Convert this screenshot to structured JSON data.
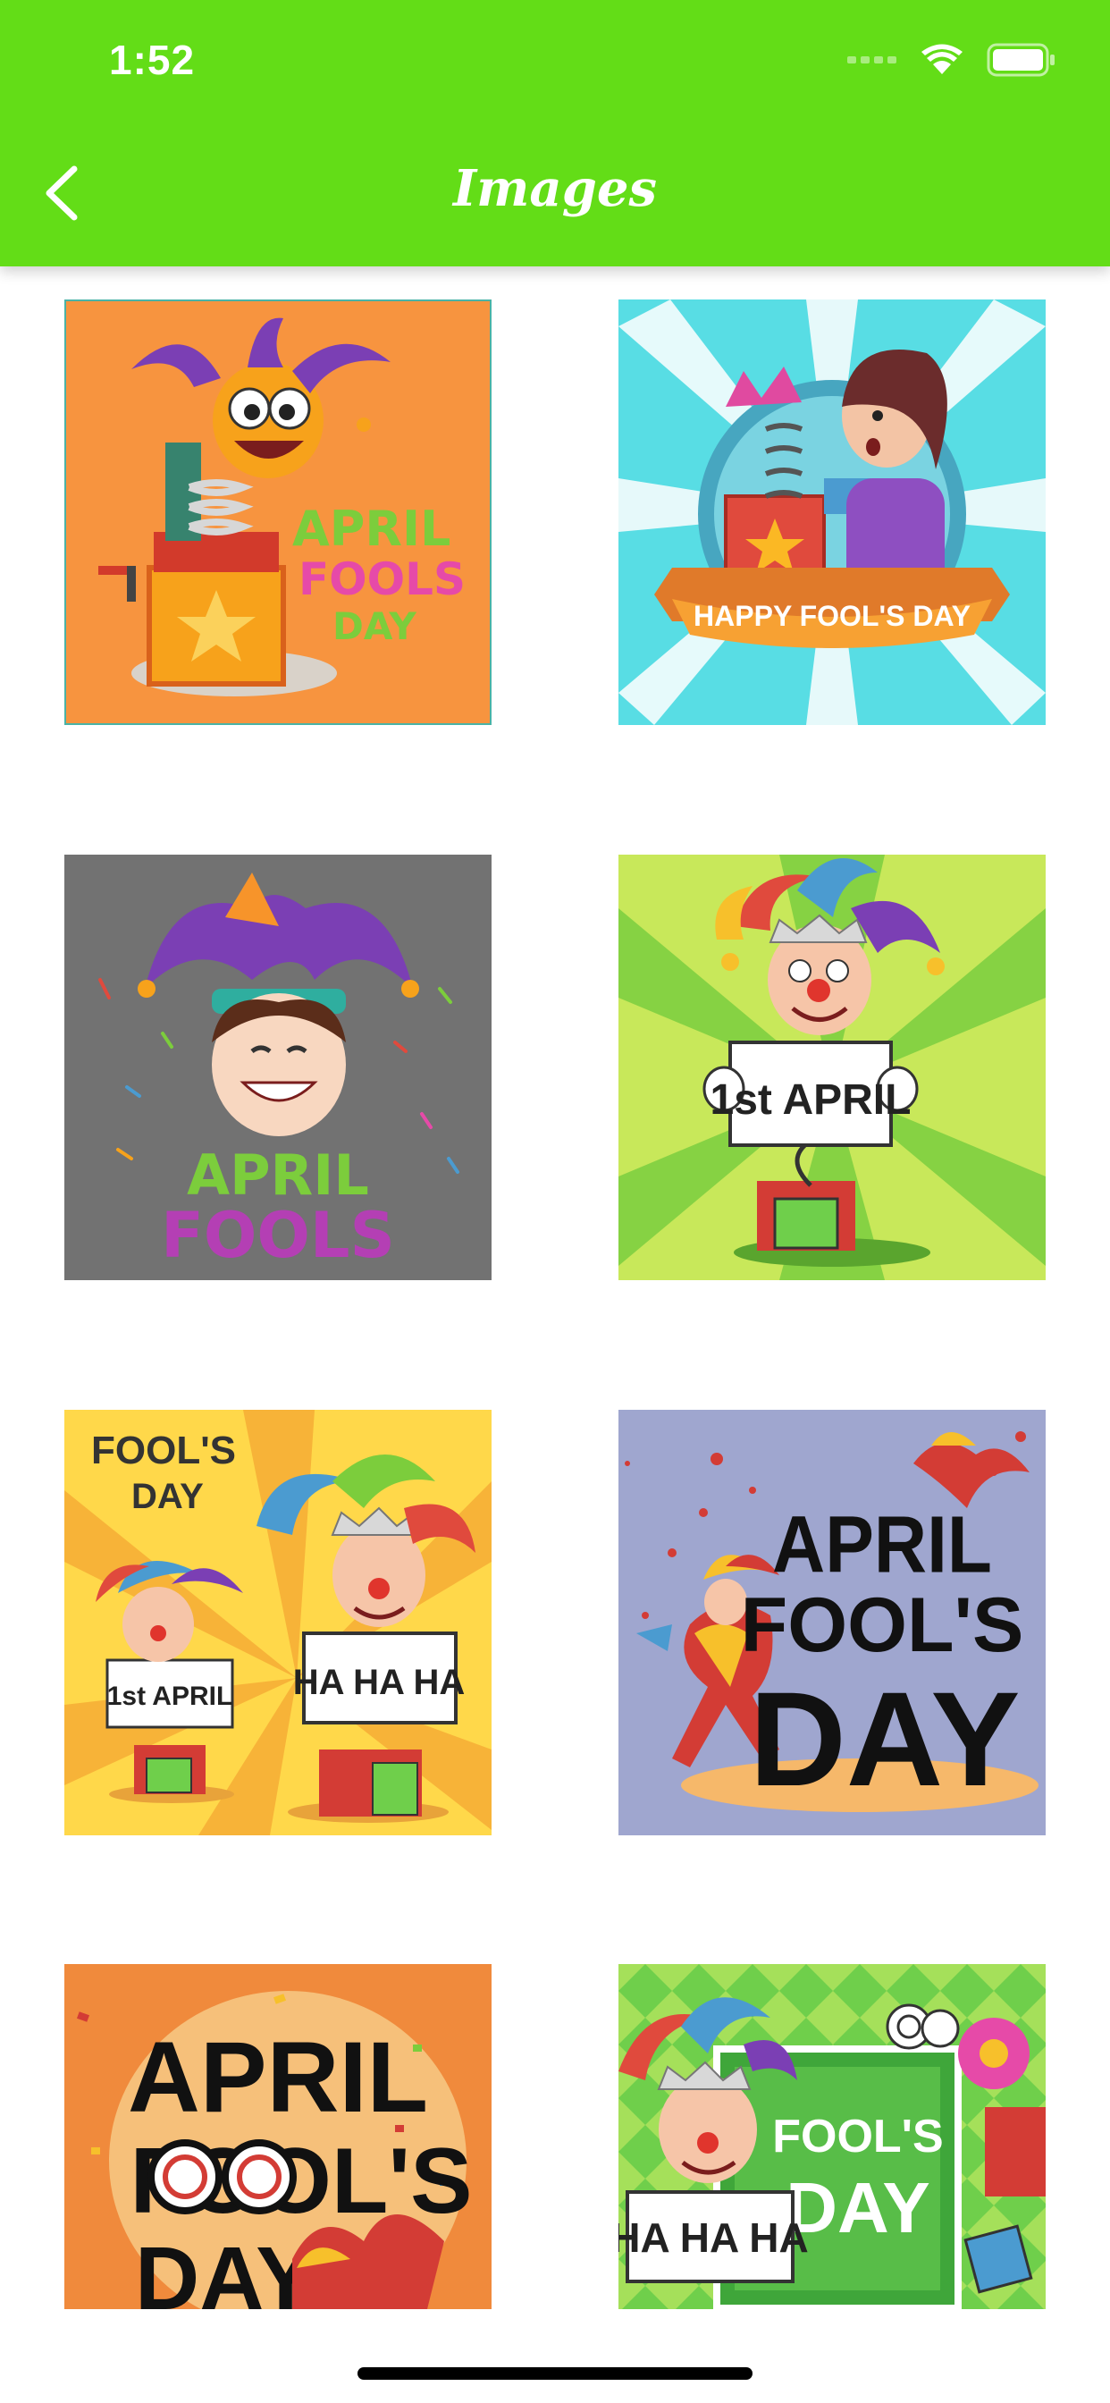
{
  "status_bar": {
    "time": "1:52"
  },
  "nav": {
    "title": "Images"
  },
  "colors": {
    "accent": "#63dd17"
  },
  "tiles": [
    {
      "name": "jack-in-the-box-april-fools",
      "text1": "APRIL",
      "text2": "FOOLS",
      "text3": "DAY"
    },
    {
      "name": "happy-fools-day-girl",
      "text1": "HAPPY FOOL'S DAY"
    },
    {
      "name": "april-fools-jester-boy",
      "text1": "APRIL",
      "text2": "FOOLS"
    },
    {
      "name": "jester-1st-april-sign",
      "text1": "1st APRIL"
    },
    {
      "name": "fools-day-ha-ha-ha",
      "text1": "FOOL'S",
      "text2": "DAY",
      "text3": "1st APRIL",
      "text4": "HA HA HA"
    },
    {
      "name": "april-fools-day-dancer",
      "text1": "APRIL",
      "text2": "FOOL'S",
      "text3": "DAY"
    },
    {
      "name": "april-fools-day-orange",
      "text1": "APRIL",
      "text2": "FOOL'S",
      "text3": "DAY"
    },
    {
      "name": "fools-day-jester-frame",
      "text1": "FOOL'S",
      "text2": "DAY",
      "text3": "HA HA HA"
    }
  ]
}
